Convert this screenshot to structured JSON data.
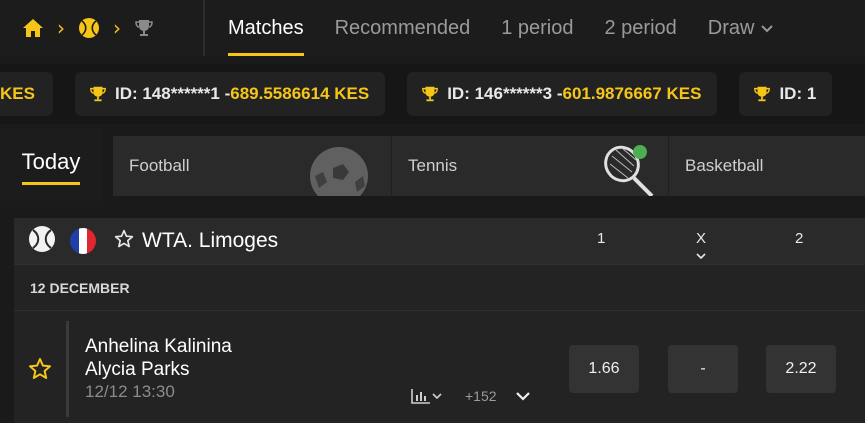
{
  "colors": {
    "accent": "#f5c518",
    "background": "#1a1a1a",
    "card": "#2a2a2a",
    "odd_button": "#333333"
  },
  "breadcrumb": {
    "icons": [
      "home-icon",
      "tennis-ball-icon",
      "trophy-icon"
    ]
  },
  "nav": {
    "tabs": [
      {
        "label": "Matches",
        "active": true
      },
      {
        "label": "Recommended"
      },
      {
        "label": "1 period"
      },
      {
        "label": "2 period"
      },
      {
        "label": "Draw",
        "dropdown": true
      }
    ]
  },
  "ticker": {
    "items": [
      {
        "label": "KES",
        "partial": true
      },
      {
        "id": "ID: 148******1 - ",
        "amount": "689.5586614 KES"
      },
      {
        "id": "ID: 146******3 - ",
        "amount": "601.9876667 KES"
      },
      {
        "id": "ID: 1",
        "amount": ""
      }
    ]
  },
  "sports": {
    "today_label": "Today",
    "cards": [
      {
        "label": "Football",
        "icon": "soccer-ball-icon"
      },
      {
        "label": "Tennis",
        "icon": "tennis-racket-icon"
      },
      {
        "label": "Basketball",
        "icon": "basketball-icon"
      }
    ]
  },
  "league": {
    "name": "WTA. Limoges",
    "country_flag": "flag-france-icon",
    "col_1": "1",
    "col_x": "X",
    "col_2": "2"
  },
  "date_header": "12 DECEMBER",
  "match": {
    "team1": "Anhelina Kalinina",
    "team2": "Alycia Parks",
    "time": "12/12 13:30",
    "more_markets": "+152",
    "odds": {
      "home": "1.66",
      "draw": "-",
      "away": "2.22"
    }
  }
}
